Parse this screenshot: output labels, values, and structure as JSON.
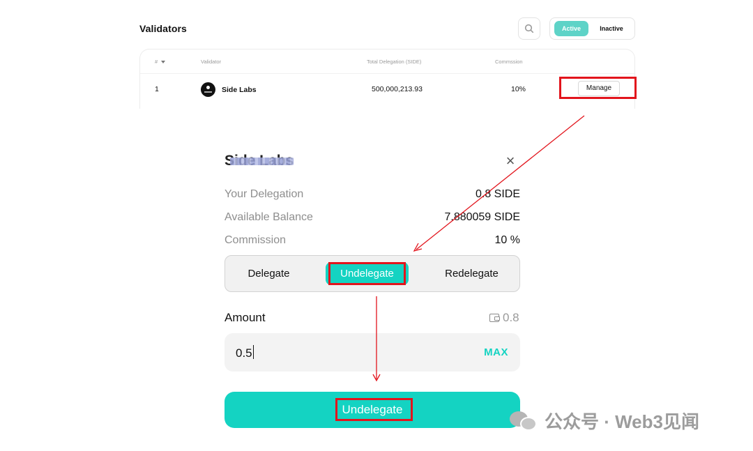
{
  "validators": {
    "title": "Validators",
    "filters": {
      "active_label": "Active",
      "inactive_label": "Inactive"
    },
    "columns": {
      "rank": "#",
      "validator": "Validator",
      "total_delegation": "Total Delegation (SIDE)",
      "commission": "Commssion"
    },
    "rows": [
      {
        "rank": "1",
        "name": "Side Labs",
        "total_delegation": "500,000,213.93",
        "commission": "10%",
        "action": "Manage"
      }
    ]
  },
  "modal": {
    "title": "Side Labs",
    "close": "×",
    "your_delegation_label": "Your Delegation",
    "your_delegation_value": "0.8 SIDE",
    "available_balance_label": "Available Balance",
    "available_balance_value": "7.880059 SIDE",
    "commission_label": "Commission",
    "commission_value": "10 %",
    "tabs": {
      "delegate": "Delegate",
      "undelegate": "Undelegate",
      "redelegate": "Redelegate"
    },
    "selected_tab": "Undelegate",
    "amount_label": "Amount",
    "amount_balance": "0.8",
    "amount_value": "0.5",
    "max_label": "MAX",
    "submit_label": "Undelegate"
  },
  "annotation": {
    "highlight_color": "#e2141c"
  },
  "watermark": {
    "text": "公众号 · Web3见闻"
  },
  "colors": {
    "accent": "#14d3c2",
    "toggle_active": "#5ed3c7"
  }
}
